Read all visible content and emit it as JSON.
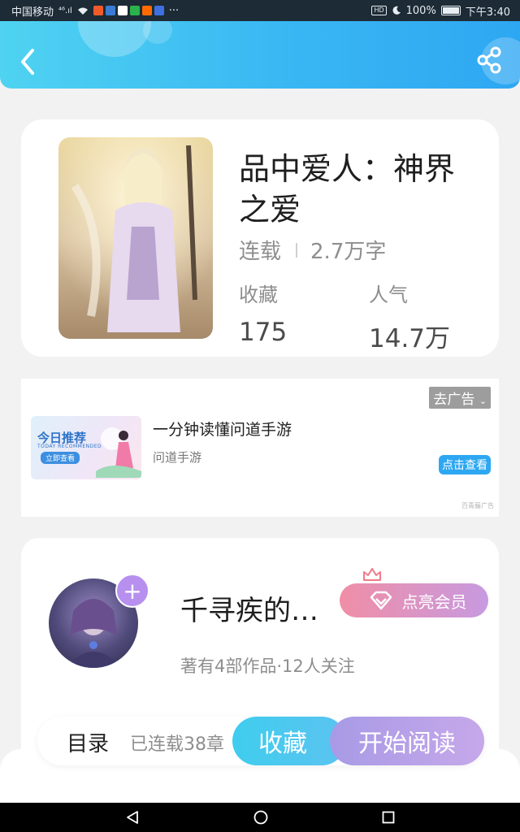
{
  "status_bar": {
    "carrier": "中国移动",
    "signal": "⁴⁶.ıl",
    "more": "···",
    "hd": "HD",
    "battery": "100%",
    "time": "下午3:40",
    "app_colors": [
      "#f05a28",
      "#3a7bd5",
      "#1f1f1f",
      "#2bb24c",
      "#ff6a00",
      "#3f6fe0"
    ]
  },
  "header": {
    "back_icon": "back-icon",
    "share_icon": "share-icon"
  },
  "book": {
    "title": "品中爱人：神界之爱",
    "status": "连载",
    "word_count": "2.7万字",
    "collect_label": "收藏",
    "collect_value": "175",
    "popularity_label": "人气",
    "popularity_value": "14.7万"
  },
  "ad": {
    "remove_label": "去广告",
    "remove_icon": "chevron-down-icon",
    "image_title": "今日推荐",
    "image_subtitle": "TODAY RECOMMENDED",
    "image_button": "立即查看",
    "title": "一分钟读懂问道手游",
    "subtitle": "问道手游",
    "view_button": "点击查看",
    "source": "百青藤广告"
  },
  "author": {
    "name": "千寻疾的…",
    "meta": "著有4部作品·12人关注",
    "follow_symbol": "+",
    "vip_label": "点亮会员",
    "vip_icon": "diamond-icon",
    "crown_icon": "crown-icon"
  },
  "bottom_bar": {
    "toc_label": "目录",
    "toc_info": "已连载38章",
    "collect_button": "收藏",
    "read_button": "开始阅读"
  },
  "colors": {
    "header_start": "#4fd3f1",
    "header_end": "#2ea7f2",
    "collect_button": "#3fcdee",
    "read_button": "#b3a2e8",
    "vip_button": "#f08ea6"
  }
}
